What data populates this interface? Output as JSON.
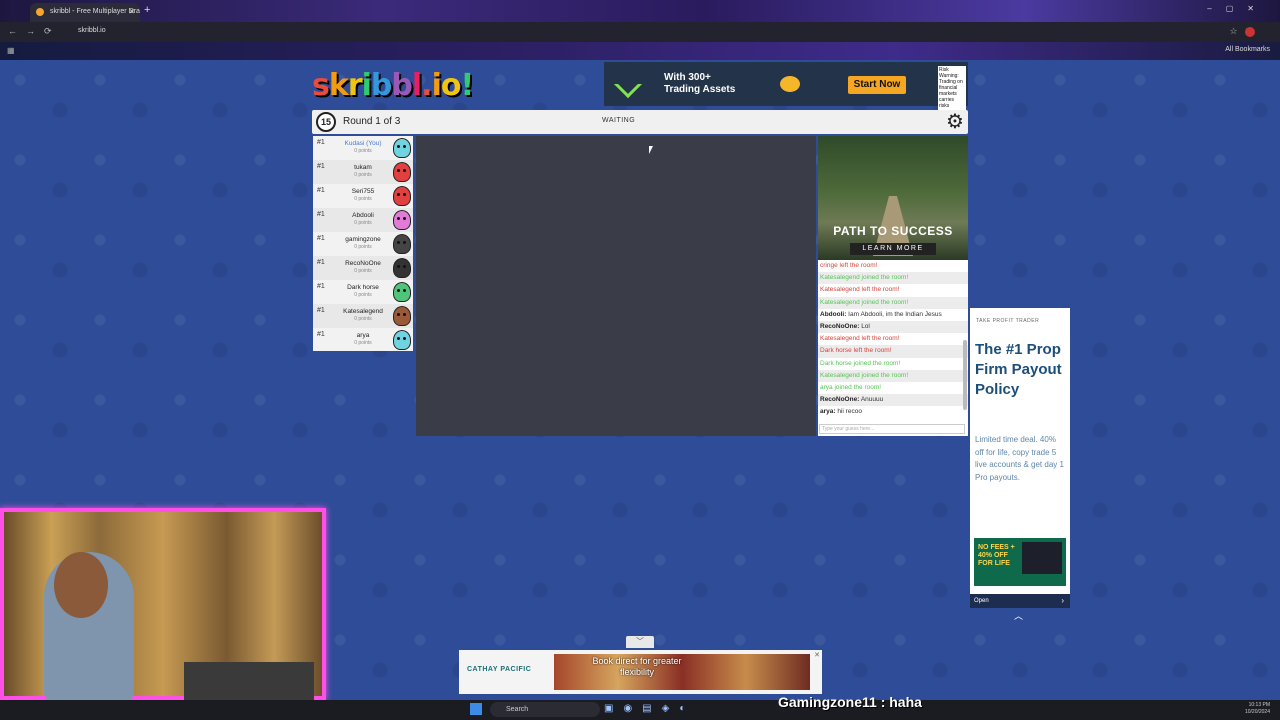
{
  "browser": {
    "tab_title": "skribbl - Free Multiplayer Dra",
    "url": "skribbl.io",
    "bookmarks_label": "All Bookmarks"
  },
  "game": {
    "logo_text": "skribbl.io!",
    "timer": "15",
    "round_label": "Round 1 of 3",
    "status": "WAITING",
    "players": [
      {
        "rank": "#1",
        "name": "Kudasi (You)",
        "points": "0 points",
        "color": "#6fd3e0",
        "me": true
      },
      {
        "rank": "#1",
        "name": "tukam",
        "points": "0 points",
        "color": "#e04040"
      },
      {
        "rank": "#1",
        "name": "Seri755",
        "points": "0 points",
        "color": "#e04040"
      },
      {
        "rank": "#1",
        "name": "Abdooli",
        "points": "0 points",
        "color": "#e27ad8"
      },
      {
        "rank": "#1",
        "name": "gamingzone",
        "points": "0 points",
        "color": "#444444"
      },
      {
        "rank": "#1",
        "name": "RecoNoOne",
        "points": "0 points",
        "color": "#333333"
      },
      {
        "rank": "#1",
        "name": "Dark horse",
        "points": "0 points",
        "color": "#4fc47a"
      },
      {
        "rank": "#1",
        "name": "Katesalegend",
        "points": "0 points",
        "color": "#9a5a3a"
      },
      {
        "rank": "#1",
        "name": "arya",
        "points": "0 points",
        "color": "#6fd3e0"
      }
    ],
    "chat": [
      {
        "type": "leave",
        "text": "cringe left the room!"
      },
      {
        "type": "join",
        "text": "Katesalegend joined the room!"
      },
      {
        "type": "leave",
        "text": "Katesalegend left the room!"
      },
      {
        "type": "join",
        "text": "Katesalegend joined the room!"
      },
      {
        "type": "msg",
        "who": "Abdooli:",
        "text": "Iam Abdooli, im the Indian Jesus"
      },
      {
        "type": "msg",
        "who": "RecoNoOne:",
        "text": "Lol"
      },
      {
        "type": "leave",
        "text": "Katesalegend left the room!"
      },
      {
        "type": "leave",
        "text": "Dark horse left the room!"
      },
      {
        "type": "join",
        "text": "Dark horse joined the room!"
      },
      {
        "type": "join",
        "text": "Katesalegend joined the room!"
      },
      {
        "type": "join",
        "text": "arya joined the room!"
      },
      {
        "type": "msg",
        "who": "RecoNoOne:",
        "text": "Anuuuu"
      },
      {
        "type": "msg",
        "who": "arya:",
        "text": "hii recoo"
      }
    ],
    "chat_placeholder": "Type your guess here..."
  },
  "ads": {
    "top": {
      "text1": "With 300+",
      "text2": "Trading Assets",
      "cta": "Start Now",
      "warning": "Risk Warning: Trading on financial markets carries risks"
    },
    "side": {
      "title": "PATH TO SUCCESS",
      "cta": "LEARN MORE"
    },
    "right": {
      "brand": "TAKE PROFIT TRADER",
      "headline": "The #1 Prop Firm Payout Policy",
      "desc": "Limited time deal. 40% off for life, copy trade 5 live accounts & get day 1 Pro payouts.",
      "badge": "NO FEES + 40% OFF FOR LIFE",
      "open": "Open"
    },
    "bottom": {
      "brand": "CATHAY PACIFIC",
      "text": "Book direct for greater flexibility"
    }
  },
  "taskbar": {
    "search": "Search",
    "time": "10:13 PM",
    "date": "10/20/2024"
  },
  "stream": {
    "chat_line": "Gamingzone11 : haha"
  }
}
